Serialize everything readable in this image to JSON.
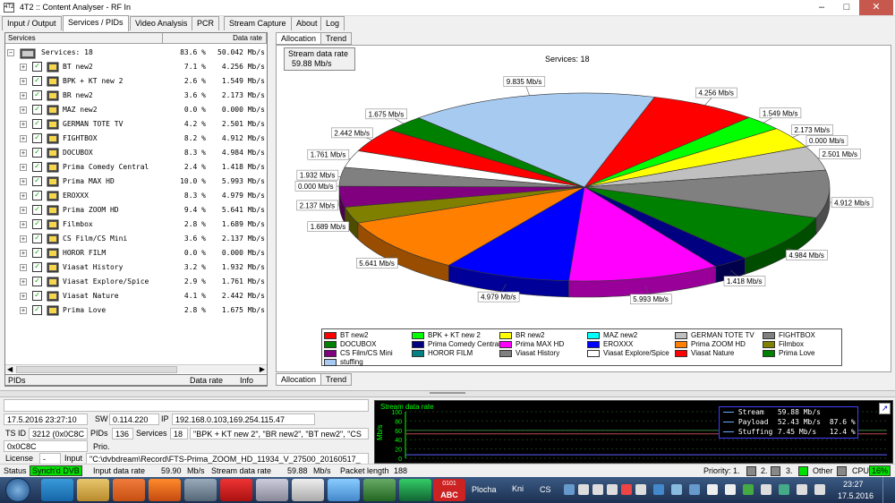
{
  "window": {
    "title": "4T2 :: Content Analyser - RF In",
    "icon_text": "4T2"
  },
  "main_tabs": [
    "Input / Output",
    "Services / PIDs",
    "Video Analysis",
    "PCR",
    "Stream Capture",
    "About",
    "Log"
  ],
  "services_panel": {
    "col_services": "Services",
    "col_rate": "Data rate",
    "root": {
      "label": "Services: 18",
      "pct": "83.6 %",
      "rate": "50.042 Mb/s"
    },
    "items": [
      {
        "name": "BT new2",
        "pct": "7.1 %",
        "rate": "4.256 Mb/s"
      },
      {
        "name": "BPK + KT new 2",
        "pct": "2.6 %",
        "rate": "1.549 Mb/s"
      },
      {
        "name": "BR new2",
        "pct": "3.6 %",
        "rate": "2.173 Mb/s"
      },
      {
        "name": "MAZ new2",
        "pct": "0.0 %",
        "rate": "0.000 Mb/s"
      },
      {
        "name": "GERMAN TOTE TV",
        "pct": "4.2 %",
        "rate": "2.501 Mb/s"
      },
      {
        "name": "FIGHTBOX",
        "pct": "8.2 %",
        "rate": "4.912 Mb/s"
      },
      {
        "name": "DOCUBOX",
        "pct": "8.3 %",
        "rate": "4.984 Mb/s"
      },
      {
        "name": "Prima Comedy Central",
        "pct": "2.4 %",
        "rate": "1.418 Mb/s"
      },
      {
        "name": "Prima MAX HD",
        "pct": "10.0 %",
        "rate": "5.993 Mb/s"
      },
      {
        "name": "EROXXX",
        "pct": "8.3 %",
        "rate": "4.979 Mb/s"
      },
      {
        "name": "Prima ZOOM HD",
        "pct": "9.4 %",
        "rate": "5.641 Mb/s"
      },
      {
        "name": "Filmbox",
        "pct": "2.8 %",
        "rate": "1.689 Mb/s"
      },
      {
        "name": "CS Film/CS Mini",
        "pct": "3.6 %",
        "rate": "2.137 Mb/s"
      },
      {
        "name": "HOROR FILM",
        "pct": "0.0 %",
        "rate": "0.000 Mb/s"
      },
      {
        "name": "Viasat History",
        "pct": "3.2 %",
        "rate": "1.932 Mb/s"
      },
      {
        "name": "Viasat Explore/Spice",
        "pct": "2.9 %",
        "rate": "1.761 Mb/s"
      },
      {
        "name": "Viasat Nature",
        "pct": "4.1 %",
        "rate": "2.442 Mb/s"
      },
      {
        "name": "Prima Love",
        "pct": "2.8 %",
        "rate": "1.675 Mb/s"
      }
    ],
    "pids_head": {
      "pids": "PIDs",
      "rate": "Data rate",
      "info": "Info"
    }
  },
  "right_tabs": {
    "top": [
      "Allocation",
      "Trend"
    ],
    "bottom": [
      "Allocation",
      "Trend"
    ]
  },
  "stream_data_rate_box": {
    "label": "Stream data rate",
    "value": "59.88 Mb/s"
  },
  "chart_data": {
    "type": "pie",
    "title": "Services: 18",
    "slices": [
      {
        "name": "BT new2",
        "value": 4.256,
        "color": "#ff0000",
        "label": "4.256 Mb/s"
      },
      {
        "name": "BPK + KT new 2",
        "value": 1.549,
        "color": "#00ff00",
        "label": "1.549 Mb/s"
      },
      {
        "name": "BR new2",
        "value": 2.173,
        "color": "#ffff00",
        "label": "2.173 Mb/s"
      },
      {
        "name": "MAZ new2",
        "value": 0.0,
        "color": "#00ffff",
        "label": "0.000 Mb/s"
      },
      {
        "name": "GERMAN TOTE TV",
        "value": 2.501,
        "color": "#c0c0c0",
        "label": "2.501 Mb/s"
      },
      {
        "name": "FIGHTBOX",
        "value": 4.912,
        "color": "#808080",
        "label": "4.912 Mb/s"
      },
      {
        "name": "DOCUBOX",
        "value": 4.984,
        "color": "#008000",
        "label": "4.984 Mb/s"
      },
      {
        "name": "Prima Comedy Central",
        "value": 1.418,
        "color": "#000080",
        "label": "1.418 Mb/s"
      },
      {
        "name": "Prima MAX HD",
        "value": 5.993,
        "color": "#ff00ff",
        "label": "5.993 Mb/s"
      },
      {
        "name": "EROXXX",
        "value": 4.979,
        "color": "#0000ff",
        "label": "4.979 Mb/s"
      },
      {
        "name": "Prima ZOOM HD",
        "value": 5.641,
        "color": "#ff8000",
        "label": "5.641 Mb/s"
      },
      {
        "name": "Filmbox",
        "value": 1.689,
        "color": "#808000",
        "label": "1.689 Mb/s"
      },
      {
        "name": "CS Film/CS Mini",
        "value": 2.137,
        "color": "#800080",
        "label": "2.137 Mb/s"
      },
      {
        "name": "HOROR FILM",
        "value": 0.0,
        "color": "#008080",
        "label": "0.000 Mb/s"
      },
      {
        "name": "Viasat History",
        "value": 1.932,
        "color": "#808080",
        "label": "1.932 Mb/s"
      },
      {
        "name": "Viasat Explore/Spice",
        "value": 1.761,
        "color": "#ffffff",
        "label": "1.761 Mb/s"
      },
      {
        "name": "Viasat Nature",
        "value": 2.442,
        "color": "#ff0000",
        "label": "2.442 Mb/s"
      },
      {
        "name": "Prima Love",
        "value": 1.675,
        "color": "#008000",
        "label": "1.675 Mb/s"
      },
      {
        "name": "stuffing",
        "value": 9.835,
        "color": "#a6caf0",
        "label": "9.835 Mb/s"
      }
    ]
  },
  "info": {
    "datetime": "17.5.2016 23:27:10",
    "sw_label": "SW",
    "sw_value": "0.114.220",
    "ip_label": "IP",
    "ip_value": "192.168.0.103,169.254.115.47",
    "tsid_label": "TS ID",
    "tsid_value": "3212 (0x0C8C",
    "pids_label": "PIDs",
    "pids_value": "136",
    "services_label": "Services",
    "services_value": "18",
    "services_list": "\"BPK + KT new 2\", \"BR new2\", \"BT new2\", \"CS",
    "ts_value": "0x0C8C",
    "prio_label": "Prio.",
    "license_label": "License",
    "license_value": "-",
    "input_label": "Input",
    "input_value": "\"C:\\dvbdream\\Record\\FTS-Prima_ZOOM_HD_11934_V_27500_20160517_"
  },
  "graph": {
    "title": "Stream data rate",
    "ylabel": "Mb/s",
    "yticks": [
      "100",
      "80",
      "60",
      "40",
      "20",
      "0"
    ],
    "legend": [
      {
        "name": "Stream",
        "value": "59.88 Mb/s",
        "pct": ""
      },
      {
        "name": "Payload",
        "value": "52.43 Mb/s",
        "pct": "87.6 %"
      },
      {
        "name": "Stuffing",
        "value": "7.45 Mb/s",
        "pct": "12.4 %"
      }
    ],
    "stream_level": 59.88,
    "payload_level": 52.43,
    "stuffing_level": 7.45
  },
  "statusbar": {
    "status_label": "Status",
    "status_value": "Synch'd DVB",
    "input_rate_label": "Input data rate",
    "input_rate_value": "59.90",
    "input_rate_unit": "Mb/s",
    "stream_rate_label": "Stream data rate",
    "stream_rate_value": "59.88",
    "stream_rate_unit": "Mb/s",
    "packet_label": "Packet length",
    "packet_value": "188",
    "priority_label": "Priority: 1.",
    "p2": "2.",
    "p3": "3.",
    "other_label": "Other",
    "cpu_label": "CPU",
    "cpu_value": "16%"
  },
  "taskbar": {
    "items": [
      "Plocha",
      "Kni",
      "CS"
    ],
    "clock_time": "23:27",
    "clock_date": "17.5.2016",
    "abc_label": "ABC",
    "abc_sub": "0101"
  }
}
